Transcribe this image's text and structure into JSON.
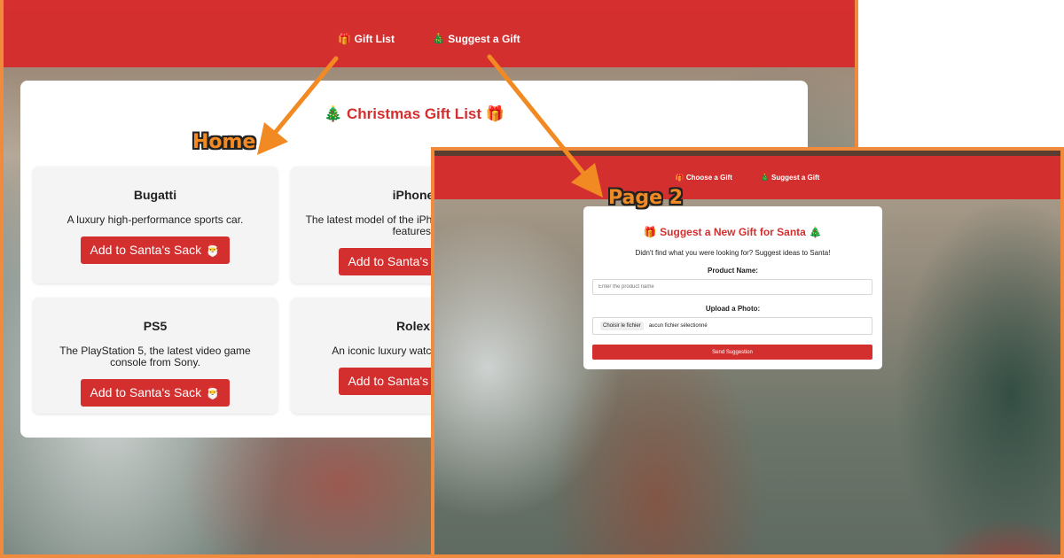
{
  "home": {
    "nav": {
      "gift_list": "🎁 Gift List",
      "suggest": "🎄 Suggest a Gift"
    },
    "title": "🎄 Christmas Gift List 🎁",
    "cards": [
      {
        "name": "Bugatti",
        "description": "A luxury high-performance sports car.",
        "button": "Add to Santa's Sack 🎅"
      },
      {
        "name": "iPhone",
        "description": "The latest model of the iPhone with advanced features.",
        "button": "Add to Santa's Sack 🎅"
      },
      {
        "name": "PS5",
        "description": "The PlayStation 5, the latest video game console from Sony.",
        "button": "Add to Santa's Sack 🎅"
      },
      {
        "name": "Rolex",
        "description": "An iconic luxury watch from Rolex.",
        "button": "Add to Santa's Sack 🎅"
      }
    ]
  },
  "page2": {
    "nav": {
      "choose": "🎁 Choose a Gift",
      "suggest": "🎄 Suggest a Gift"
    },
    "title": "🎁 Suggest a New Gift for Santa 🎄",
    "subtitle": "Didn't find what you were looking for? Suggest ideas to Santa!",
    "product_label": "Product Name:",
    "product_placeholder": "Enter the product name",
    "photo_label": "Upload a Photo:",
    "file_button": "Choisir le fichier",
    "file_status": "aucun fichier sélectionné",
    "send_button": "Send Suggestion"
  },
  "annotations": {
    "home": "Home",
    "page2": "Page 2"
  },
  "colors": {
    "primary_red": "#d32f2f",
    "annotation_orange": "#f28a24",
    "frame_orange": "#f08a3c"
  }
}
